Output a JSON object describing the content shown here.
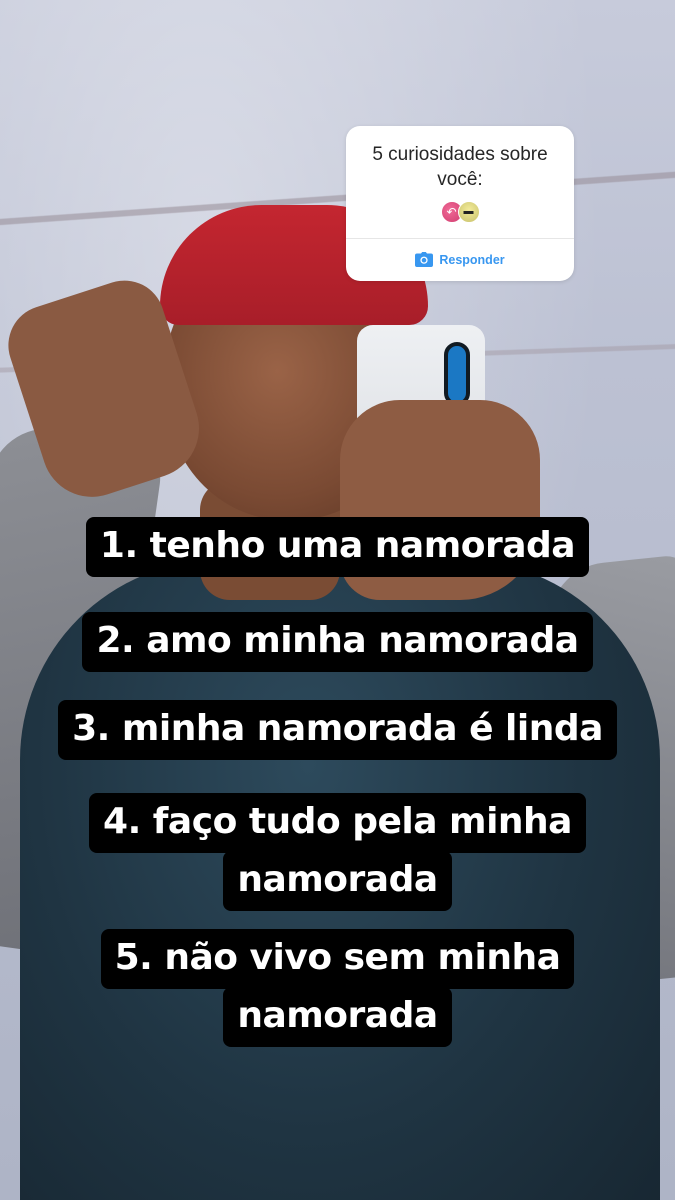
{
  "sticker": {
    "question": "5 curiosidades sobre você:",
    "reply_label": "Responder",
    "avatars": [
      {
        "icon": "reply-arrow-icon",
        "color": "#e0497d"
      },
      {
        "icon": "sunglasses-face-icon",
        "color": "#d9d27f"
      }
    ],
    "accent_color": "#3897f0"
  },
  "captions": [
    {
      "lines": [
        "1. tenho uma namorada"
      ]
    },
    {
      "lines": [
        "2. amo minha namorada"
      ]
    },
    {
      "lines": [
        "3. minha namorada é linda"
      ]
    },
    {
      "lines": [
        "4. faço tudo pela minha",
        "namorada"
      ]
    },
    {
      "lines": [
        "5. não vivo sem minha",
        "namorada"
      ]
    }
  ],
  "colors": {
    "caption_background": "#000000",
    "caption_text": "#ffffff",
    "beanie": "#c42630",
    "shirt": "#1f3442"
  }
}
